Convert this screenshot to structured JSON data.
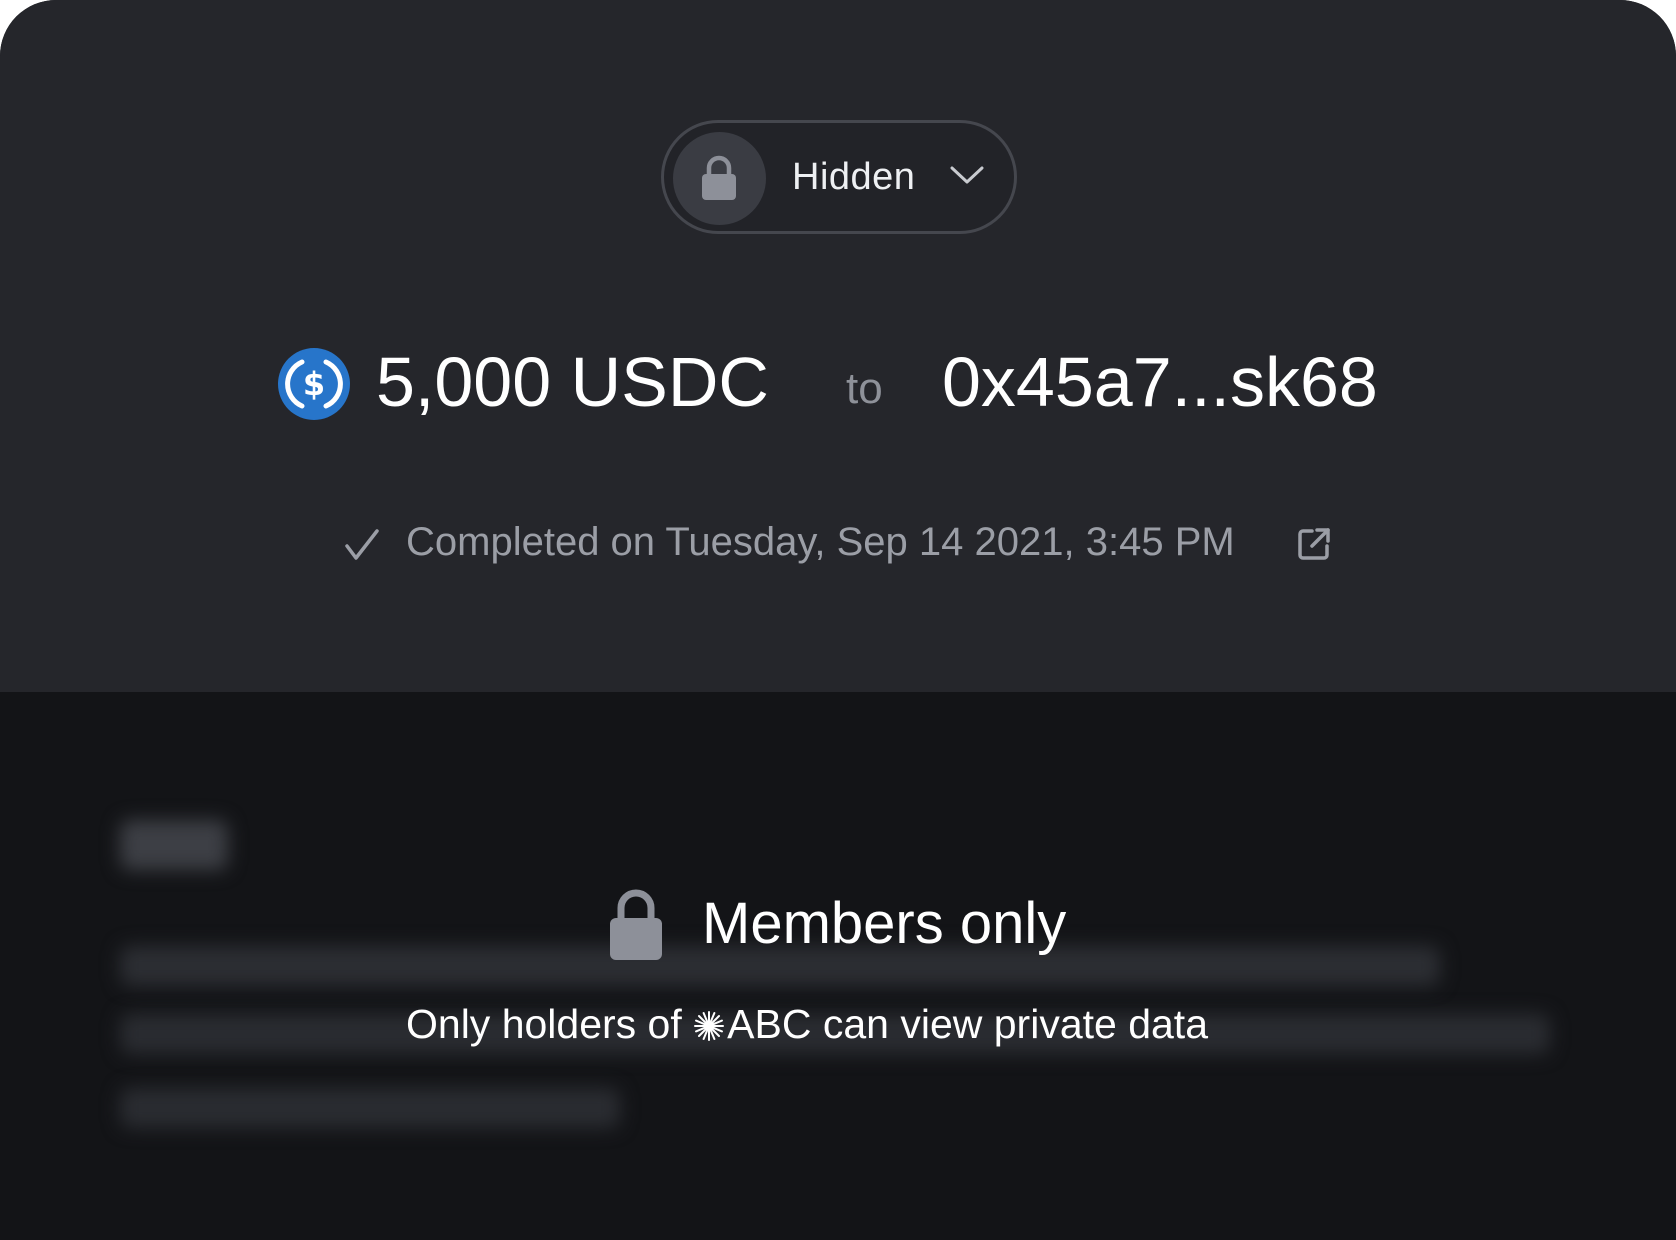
{
  "visibility": {
    "label": "Hidden",
    "icon": "lock-icon",
    "dropdown_icon": "chevron-down-icon"
  },
  "transfer": {
    "amount": "5,000 USDC",
    "token_icon": "usdc-icon",
    "to_label": "to",
    "recipient": "0x45a7...sk68"
  },
  "status": {
    "icon": "check-icon",
    "text": "Completed on Tuesday, Sep 14 2021, 3:45 PM",
    "link_icon": "external-link-icon"
  },
  "gate": {
    "icon": "lock-icon",
    "title": "Members only",
    "subtitle_prefix": "Only holders of ",
    "token_glyph": "sunburst-icon",
    "token_symbol": "ABC",
    "subtitle_suffix": " can view private data"
  },
  "colors": {
    "top_panel": "#25262b",
    "bottom_panel": "#131417",
    "usdc_blue": "#2775ca",
    "muted_text": "#9b9ea6"
  }
}
